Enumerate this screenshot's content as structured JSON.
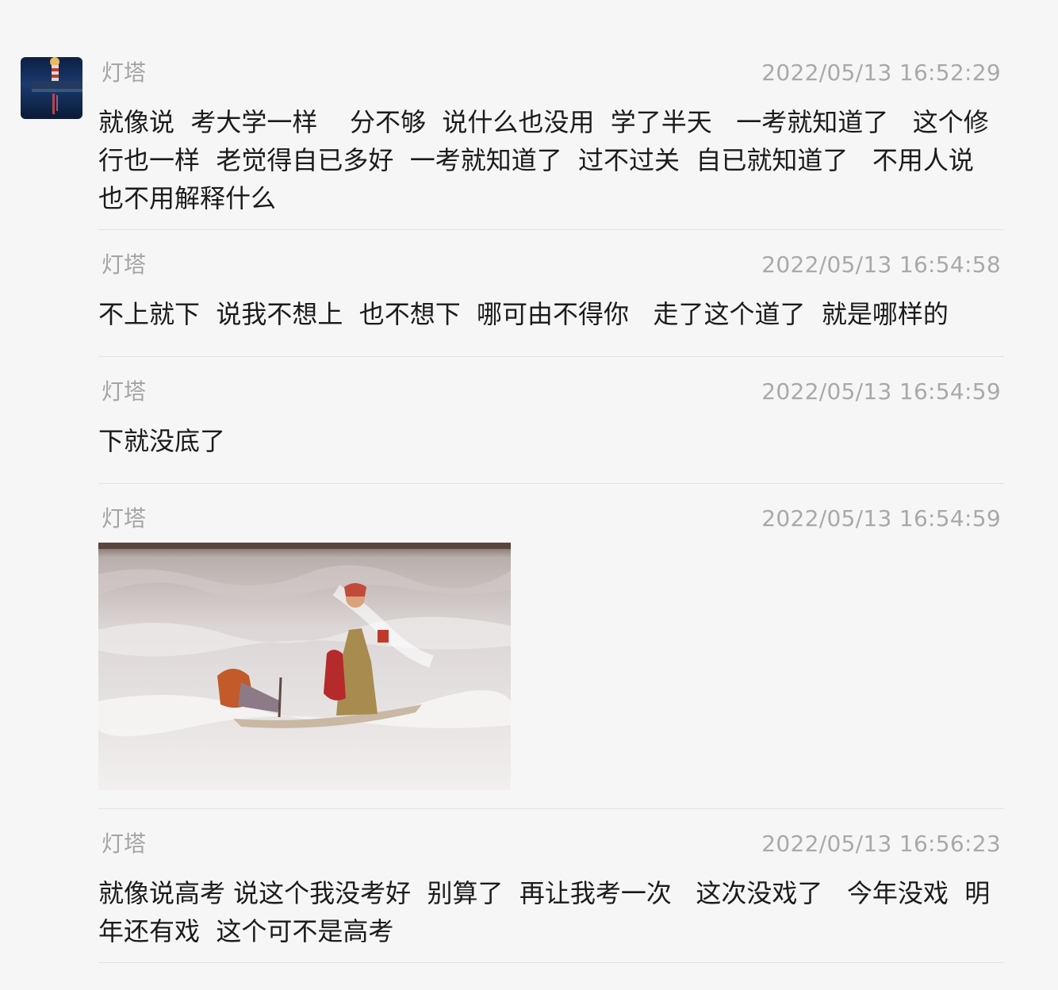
{
  "contact": {
    "name": "灯塔",
    "avatar_icon": "lighthouse-avatar"
  },
  "messages": [
    {
      "sender": "灯塔",
      "time": "2022/05/13 16:52:29",
      "type": "text",
      "text": "就像说  考大学一样    分不够  说什么也没用  学了半天   一考就知道了   这个修行也一样  老觉得自已多好  一考就知道了  过不过关  自已就知道了   不用人说也不用解释什么"
    },
    {
      "sender": "灯塔",
      "time": "2022/05/13 16:54:58",
      "type": "text",
      "text": "不上就下  说我不想上  也不想下  哪可由不得你   走了这个道了  就是哪样的"
    },
    {
      "sender": "灯塔",
      "time": "2022/05/13 16:54:59",
      "type": "text",
      "text": "下就没底了"
    },
    {
      "sender": "灯塔",
      "time": "2022/05/13 16:54:59",
      "type": "image"
    },
    {
      "sender": "灯塔",
      "time": "2022/05/13 16:56:23",
      "type": "text",
      "text": "就像说高考 说这个我没考好  别算了  再让我考一次   这次没戏了   今年没戏  明年还有戏  这个可不是高考"
    }
  ]
}
